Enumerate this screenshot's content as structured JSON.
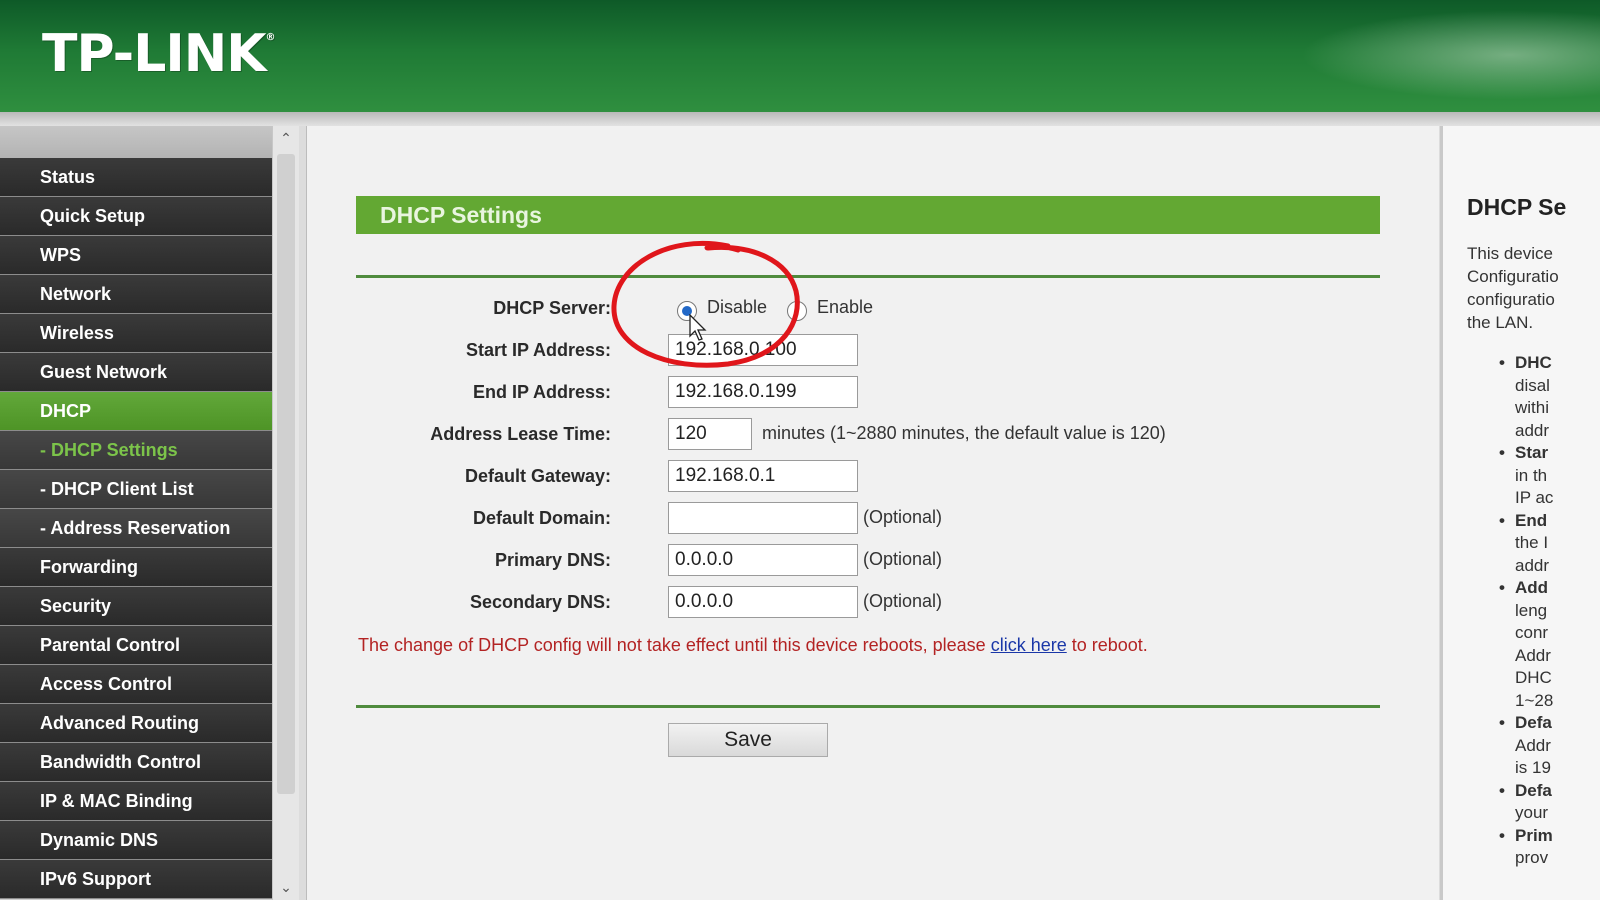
{
  "header": {
    "logo": "TP-LINK",
    "logo_mark": "®"
  },
  "sidebar": {
    "items": [
      {
        "label": "Status",
        "type": "main"
      },
      {
        "label": "Quick Setup",
        "type": "main"
      },
      {
        "label": "WPS",
        "type": "main"
      },
      {
        "label": "Network",
        "type": "main"
      },
      {
        "label": "Wireless",
        "type": "main"
      },
      {
        "label": "Guest Network",
        "type": "main"
      },
      {
        "label": "DHCP",
        "type": "main",
        "active": true
      },
      {
        "label": "- DHCP Settings",
        "type": "sub",
        "active": true
      },
      {
        "label": "- DHCP Client List",
        "type": "sub"
      },
      {
        "label": "- Address Reservation",
        "type": "sub"
      },
      {
        "label": "Forwarding",
        "type": "main"
      },
      {
        "label": "Security",
        "type": "main"
      },
      {
        "label": "Parental Control",
        "type": "main"
      },
      {
        "label": "Access Control",
        "type": "main"
      },
      {
        "label": "Advanced Routing",
        "type": "main"
      },
      {
        "label": "Bandwidth Control",
        "type": "main"
      },
      {
        "label": "IP & MAC Binding",
        "type": "main"
      },
      {
        "label": "Dynamic DNS",
        "type": "main"
      },
      {
        "label": "IPv6 Support",
        "type": "main"
      }
    ],
    "scroll_up_icon": "chevron-up-icon",
    "scroll_down_icon": "chevron-down-icon"
  },
  "main": {
    "title": "DHCP Settings",
    "dhcp_server": {
      "label": "DHCP Server:",
      "options": [
        "Disable",
        "Enable"
      ],
      "selected": "Disable"
    },
    "start_ip": {
      "label": "Start IP Address:",
      "value": "192.168.0.100"
    },
    "end_ip": {
      "label": "End IP Address:",
      "value": "192.168.0.199"
    },
    "lease_time": {
      "label": "Address Lease Time:",
      "value": "120",
      "hint": "minutes (1~2880 minutes, the default value is 120)"
    },
    "gateway": {
      "label": "Default Gateway:",
      "value": "192.168.0.1"
    },
    "domain": {
      "label": "Default Domain:",
      "value": "",
      "hint": "(Optional)"
    },
    "primary_dns": {
      "label": "Primary DNS:",
      "value": "0.0.0.0",
      "hint": "(Optional)"
    },
    "secondary_dns": {
      "label": "Secondary DNS:",
      "value": "0.0.0.0",
      "hint": "(Optional)"
    },
    "reboot_notice": {
      "before": "The change of DHCP config will not take effect until this device reboots, please ",
      "link": "click here",
      "after": " to reboot."
    },
    "save_label": "Save"
  },
  "help": {
    "title": "DHCP Se",
    "intro_lines": [
      "This device",
      "Configuratio",
      "configuratio",
      "the LAN."
    ],
    "items": [
      {
        "head": "DHC",
        "lines": [
          "disal",
          "withi",
          "addr"
        ]
      },
      {
        "head": "Star",
        "lines": [
          "in th",
          "IP ac"
        ]
      },
      {
        "head": "End",
        "lines": [
          "the I",
          "addr"
        ]
      },
      {
        "head": "Add",
        "lines": [
          "leng",
          "conr",
          "Addr",
          "DHC",
          "1~28"
        ]
      },
      {
        "head": "Defa",
        "lines": [
          "Addr",
          "is 19"
        ]
      },
      {
        "head": "Defa",
        "lines": [
          "your"
        ]
      },
      {
        "head": "Prim",
        "lines": [
          "prov"
        ]
      }
    ]
  },
  "colors": {
    "header_green": "#1f7a35",
    "title_bar_green": "#63a833",
    "menu_active": "#5aa032",
    "menu_dark": "#333333",
    "notice_red": "#b32323",
    "link_blue": "#1a37a8",
    "annotation_red": "#e0161b"
  }
}
